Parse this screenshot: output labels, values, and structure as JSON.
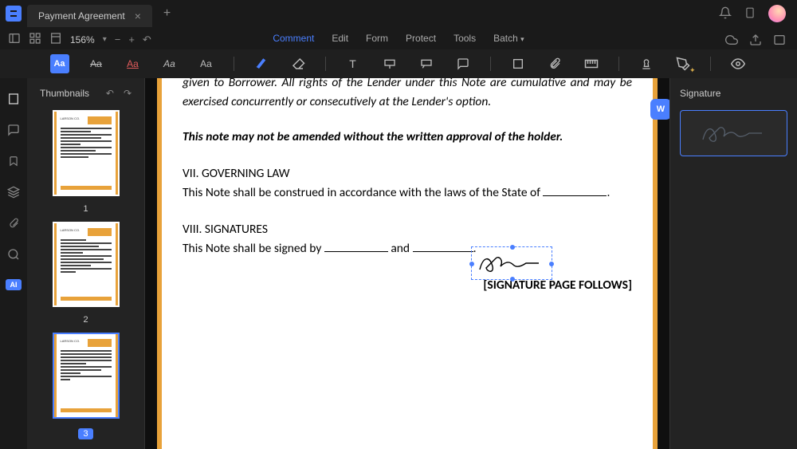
{
  "titlebar": {
    "tab_title": "Payment Agreement"
  },
  "menubar": {
    "items": [
      "Comment",
      "Edit",
      "Form",
      "Protect",
      "Tools",
      "Batch"
    ],
    "active_index": 0
  },
  "zoom": "156%",
  "thumbnails": {
    "title": "Thumbnails",
    "pages": [
      "1",
      "2",
      "3"
    ],
    "selected_index": 2
  },
  "signature_panel": {
    "title": "Signature"
  },
  "document": {
    "para_top": "given to Borrower. All rights of the Lender under this Note are cumulative and may be exercised concurrently or consecutively at the Lender's option.",
    "amend": "This note may not be amended without the written approval of the holder.",
    "law_title": "VII. GOVERNING LAW",
    "law_body_a": "This Note shall be construed in accordance with the laws of the State of ",
    "sig_title": "VIII. SIGNATURES",
    "sig_body_a": "This Note shall be signed by ",
    "sig_body_b": " and ",
    "sig_follow": "[SIGNATURE PAGE FOLLOWS]"
  },
  "chart_data": null
}
